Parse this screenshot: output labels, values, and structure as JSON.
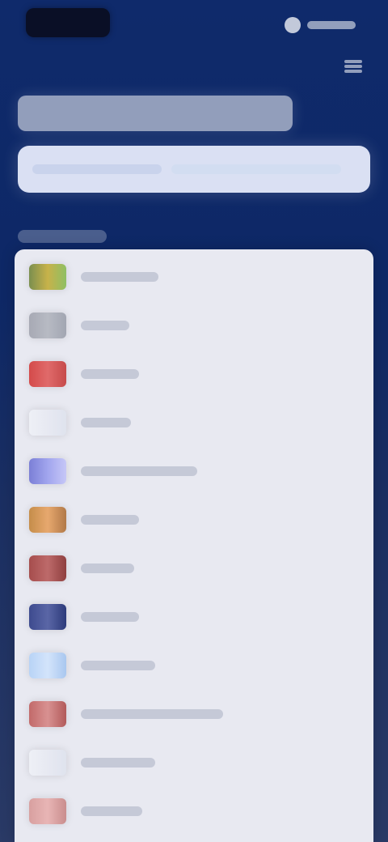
{
  "header": {
    "logo": {
      "icon": "brand-logo-icon"
    },
    "language": {
      "icon": "globe-icon"
    },
    "menu": {
      "icon": "hamburger-menu-icon"
    }
  },
  "hero": {},
  "search": {
    "icon": "search-icon"
  },
  "list": {
    "items": [
      {
        "flag_colors": [
          "#7b8f4f",
          "#c7b24a",
          "#8fbf63"
        ]
      },
      {
        "flag_colors": [
          "#a7a9b4",
          "#b7bac3",
          "#a2a6b2"
        ]
      },
      {
        "flag_colors": [
          "#d44a4a",
          "#e06a6a",
          "#c64a4a"
        ]
      },
      {
        "flag_colors": [
          "#eef0f6",
          "#e7e9f2",
          "#dfe3ee"
        ]
      },
      {
        "flag_colors": [
          "#7b7fd6",
          "#a1a5ee",
          "#c6c7f7"
        ]
      },
      {
        "flag_colors": [
          "#c58d4a",
          "#e7a86e",
          "#b17948"
        ]
      },
      {
        "flag_colors": [
          "#a64d4d",
          "#bd6a6a",
          "#8f3f3f"
        ]
      },
      {
        "flag_colors": [
          "#3e4b8f",
          "#5a66a6",
          "#2c3a7a"
        ]
      },
      {
        "flag_colors": [
          "#b8d3f6",
          "#d3e4fb",
          "#a9c7ef"
        ]
      },
      {
        "flag_colors": [
          "#c26a6a",
          "#d89191",
          "#b25a5a"
        ]
      },
      {
        "flag_colors": [
          "#eef0f6",
          "#e7e9f2",
          "#dfe3ee"
        ]
      },
      {
        "flag_colors": [
          "#d8a0a0",
          "#e8b5b5",
          "#c98d8d"
        ]
      }
    ]
  }
}
